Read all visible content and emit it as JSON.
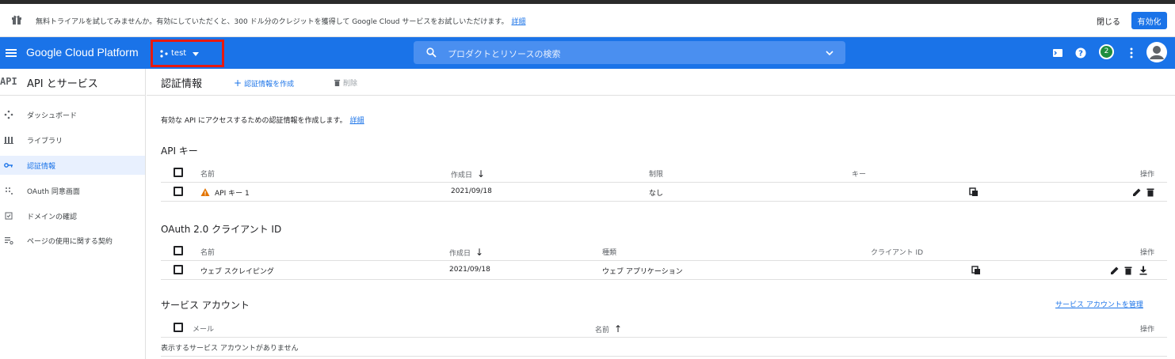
{
  "banner": {
    "message": "無料トライアルを試してみませんか。有効にしていただくと、300 ドル分のクレジットを獲得して Google Cloud サービスをお試しいただけます。",
    "details_link": "詳細",
    "close_label": "閉じる",
    "enable_label": "有効化"
  },
  "header": {
    "brand": "Google Cloud Platform",
    "project": "test",
    "search_placeholder": "プロダクトとリソースの検索",
    "notification_count": "2"
  },
  "sidebar": {
    "logo": "API",
    "title": "API とサービス",
    "items": [
      {
        "label": "ダッシュボード",
        "icon": "dashboard-icon"
      },
      {
        "label": "ライブラリ",
        "icon": "library-icon"
      },
      {
        "label": "認証情報",
        "icon": "key-icon"
      },
      {
        "label": "OAuth 同意画面",
        "icon": "oauth-consent-icon"
      },
      {
        "label": "ドメインの確認",
        "icon": "domain-check-icon"
      },
      {
        "label": "ページの使用に関する契約",
        "icon": "page-agreement-icon"
      }
    ]
  },
  "toolbar": {
    "title": "認証情報",
    "create_label": "認証情報を作成",
    "delete_label": "削除"
  },
  "description": {
    "text": "有効な API にアクセスするための認証情報を作成します。",
    "link": "詳細"
  },
  "api_keys": {
    "title": "API キー",
    "columns": {
      "name": "名前",
      "created": "作成日",
      "restriction": "制限",
      "key": "キー",
      "actions": "操作"
    },
    "rows": [
      {
        "name": "API キー 1",
        "created": "2021/09/18",
        "restriction": "なし"
      }
    ]
  },
  "oauth_clients": {
    "title": "OAuth 2.0 クライアント ID",
    "columns": {
      "name": "名前",
      "created": "作成日",
      "type": "種類",
      "client_id": "クライアント ID",
      "actions": "操作"
    },
    "rows": [
      {
        "name": "ウェブ スクレイピング",
        "created": "2021/09/18",
        "type": "ウェブ アプリケーション"
      }
    ]
  },
  "service_accounts": {
    "title": "サービス アカウント",
    "manage_link": "サービス アカウントを管理",
    "columns": {
      "email": "メール",
      "name": "名前",
      "actions": "操作"
    },
    "empty_message": "表示するサービス アカウントがありません"
  },
  "colors": {
    "primary": "#1a73e8",
    "highlight_border": "#e8190f",
    "warning": "#e37400",
    "badge": "#1e8e3e"
  }
}
